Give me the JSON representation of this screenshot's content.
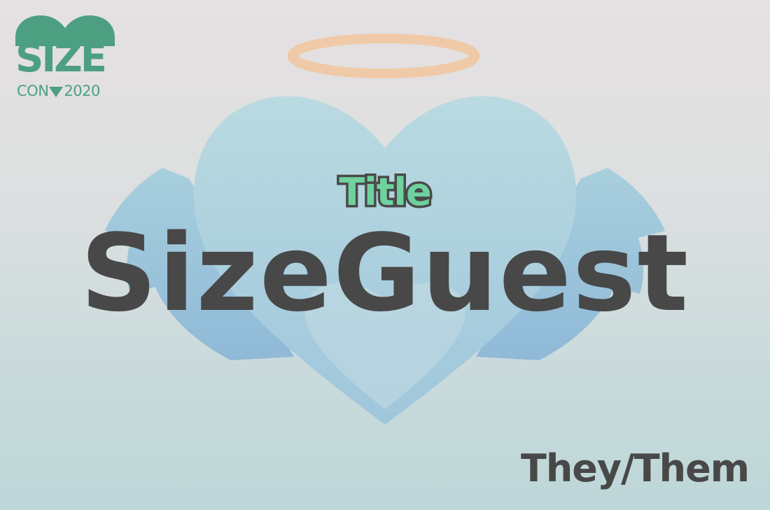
{
  "logo": {
    "main_text": "SIZE",
    "left_text": "CON",
    "right_text": "2020",
    "color": "#4d9f82"
  },
  "badge": {
    "role": "Title",
    "name": "SizeGuest",
    "pronouns": "They/Them"
  },
  "colors": {
    "background_top": "#e6e1e2",
    "background_bottom": "#bdd6d8",
    "heart": "#a9cfdb",
    "wings": "#98c2d8",
    "halo": "#f1c8a6",
    "role_fill": "#6ed29f",
    "text": "#484848"
  }
}
